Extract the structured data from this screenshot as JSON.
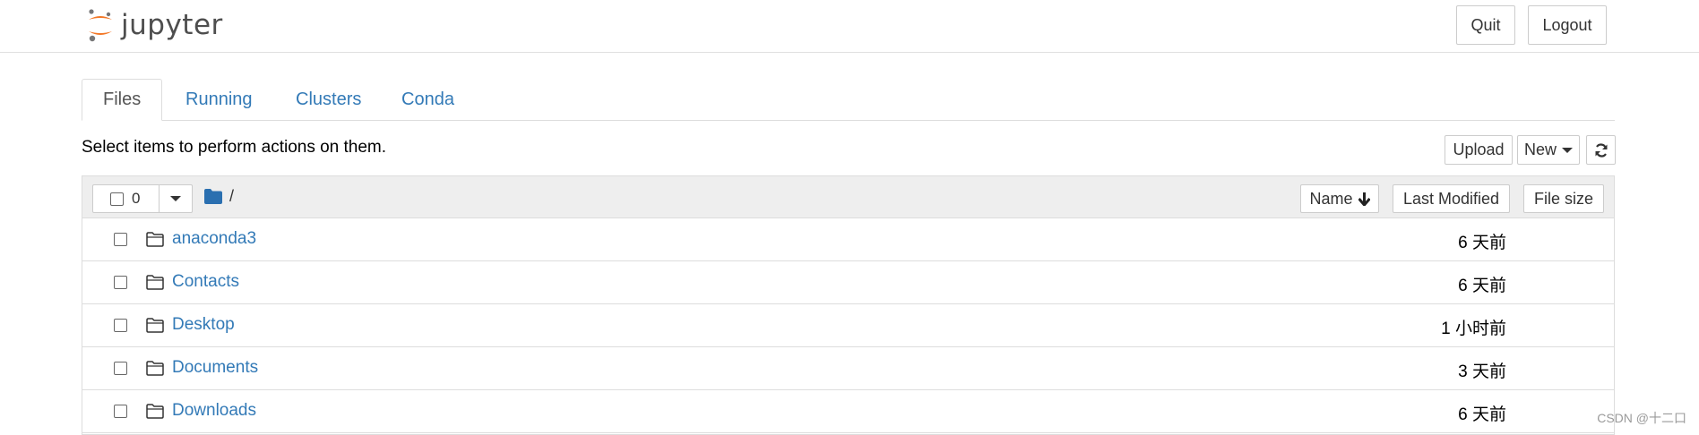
{
  "header": {
    "logo_text": "jupyter",
    "quit_label": "Quit",
    "logout_label": "Logout"
  },
  "tabs": [
    {
      "label": "Files",
      "active": true
    },
    {
      "label": "Running",
      "active": false
    },
    {
      "label": "Clusters",
      "active": false
    },
    {
      "label": "Conda",
      "active": false
    }
  ],
  "toolbar": {
    "hint": "Select items to perform actions on them.",
    "upload_label": "Upload",
    "new_label": "New",
    "refresh_icon": "refresh-icon"
  },
  "list_header": {
    "selected_count": "0",
    "breadcrumb": "/",
    "name_label": "Name",
    "last_modified_label": "Last Modified",
    "file_size_label": "File size"
  },
  "rows": [
    {
      "name": "anaconda3",
      "modified": "6 天前"
    },
    {
      "name": "Contacts",
      "modified": "6 天前"
    },
    {
      "name": "Desktop",
      "modified": "1 小时前"
    },
    {
      "name": "Documents",
      "modified": "3 天前"
    },
    {
      "name": "Downloads",
      "modified": "6 天前"
    }
  ],
  "watermark": "CSDN @十二口",
  "colors": {
    "link": "#337ab7",
    "logo_orange": "#f37726",
    "logo_gray": "#767677",
    "folder_blue": "#2a6fb0"
  }
}
